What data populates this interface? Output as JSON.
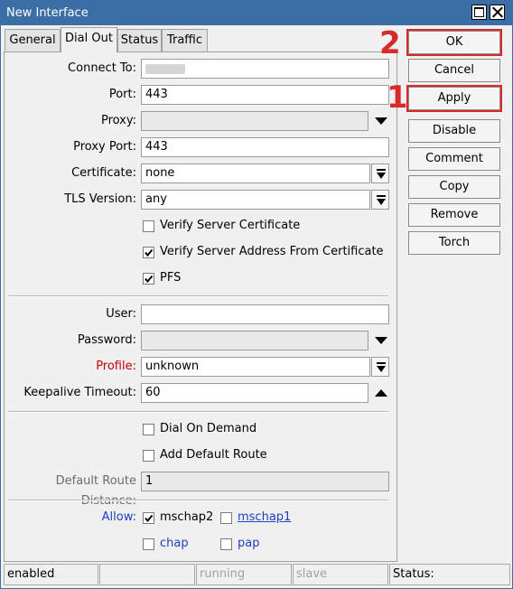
{
  "window": {
    "title": "New Interface"
  },
  "tabs": [
    {
      "label": "General"
    },
    {
      "label": "Dial Out"
    },
    {
      "label": "Status"
    },
    {
      "label": "Traffic"
    }
  ],
  "form": {
    "connect_to": {
      "label": "Connect To:",
      "value": ""
    },
    "port": {
      "label": "Port:",
      "value": "443"
    },
    "proxy": {
      "label": "Proxy:",
      "value": ""
    },
    "proxy_port": {
      "label": "Proxy Port:",
      "value": "443"
    },
    "certificate": {
      "label": "Certificate:",
      "value": "none"
    },
    "tls_version": {
      "label": "TLS Version:",
      "value": "any"
    },
    "verify_server_certificate": {
      "label": "Verify Server Certificate",
      "checked": false
    },
    "verify_server_address": {
      "label": "Verify Server Address From Certificate",
      "checked": true
    },
    "pfs": {
      "label": "PFS",
      "checked": true
    },
    "user": {
      "label": "User:",
      "value": ""
    },
    "password": {
      "label": "Password:",
      "value": ""
    },
    "profile": {
      "label": "Profile:",
      "value": "unknown"
    },
    "keepalive_timeout": {
      "label": "Keepalive Timeout:",
      "value": "60"
    },
    "dial_on_demand": {
      "label": "Dial On Demand",
      "checked": false
    },
    "add_default_route": {
      "label": "Add Default Route",
      "checked": false
    },
    "default_route_distance": {
      "label": "Default Route Distance:",
      "value": "1"
    },
    "allow": {
      "label": "Allow:",
      "options": [
        {
          "label": "mschap2",
          "checked": true
        },
        {
          "label": "mschap1",
          "checked": false
        },
        {
          "label": "chap",
          "checked": false
        },
        {
          "label": "pap",
          "checked": false
        }
      ]
    }
  },
  "buttons": {
    "ok": "OK",
    "cancel": "Cancel",
    "apply": "Apply",
    "disable": "Disable",
    "comment": "Comment",
    "copy": "Copy",
    "remove": "Remove",
    "torch": "Torch"
  },
  "annotations": {
    "ok_step": "2",
    "apply_step": "1",
    "highlight_color": "#d72b2b"
  },
  "statusbar": {
    "state": "enabled",
    "blank": "",
    "running": "running",
    "slave": "slave",
    "status": "Status:"
  },
  "colors": {
    "titlebar": "#3a6ea5",
    "required_label": "#c00000",
    "link": "#1a3fbf"
  }
}
